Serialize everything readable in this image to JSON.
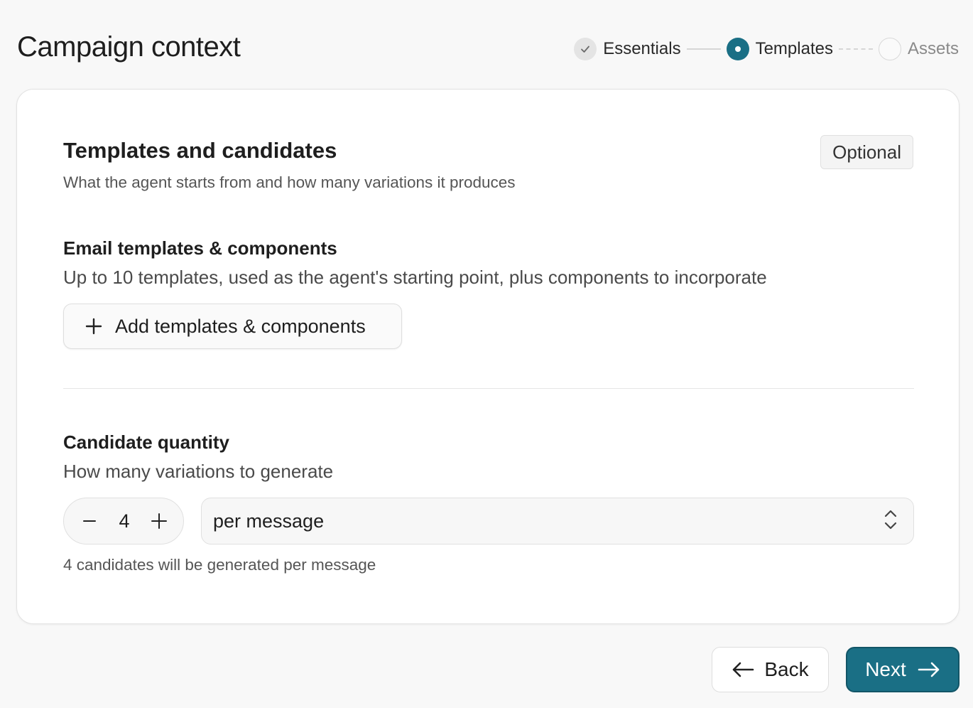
{
  "header": {
    "title": "Campaign context"
  },
  "stepper": {
    "steps": [
      {
        "label": "Essentials",
        "state": "done"
      },
      {
        "label": "Templates",
        "state": "current"
      },
      {
        "label": "Assets",
        "state": "todo"
      }
    ]
  },
  "card": {
    "title": "Templates and candidates",
    "subtitle": "What the agent starts from and how many variations it produces",
    "badge": "Optional",
    "templates": {
      "title": "Email templates & components",
      "description": "Up to 10 templates, used as the agent's starting point, plus components to incorporate",
      "add_label": "Add templates & components"
    },
    "quantity": {
      "title": "Candidate quantity",
      "description": "How many variations to generate",
      "value": "4",
      "unit": "per message",
      "helper": "4 candidates will be generated per message"
    }
  },
  "footer": {
    "back_label": "Back",
    "next_label": "Next"
  },
  "colors": {
    "accent": "#1a6f85",
    "background": "#f8f8f8"
  },
  "icons": [
    "check-icon",
    "plus-icon",
    "minus-icon",
    "chevron-up-down-icon",
    "arrow-left-icon",
    "arrow-right-icon"
  ]
}
